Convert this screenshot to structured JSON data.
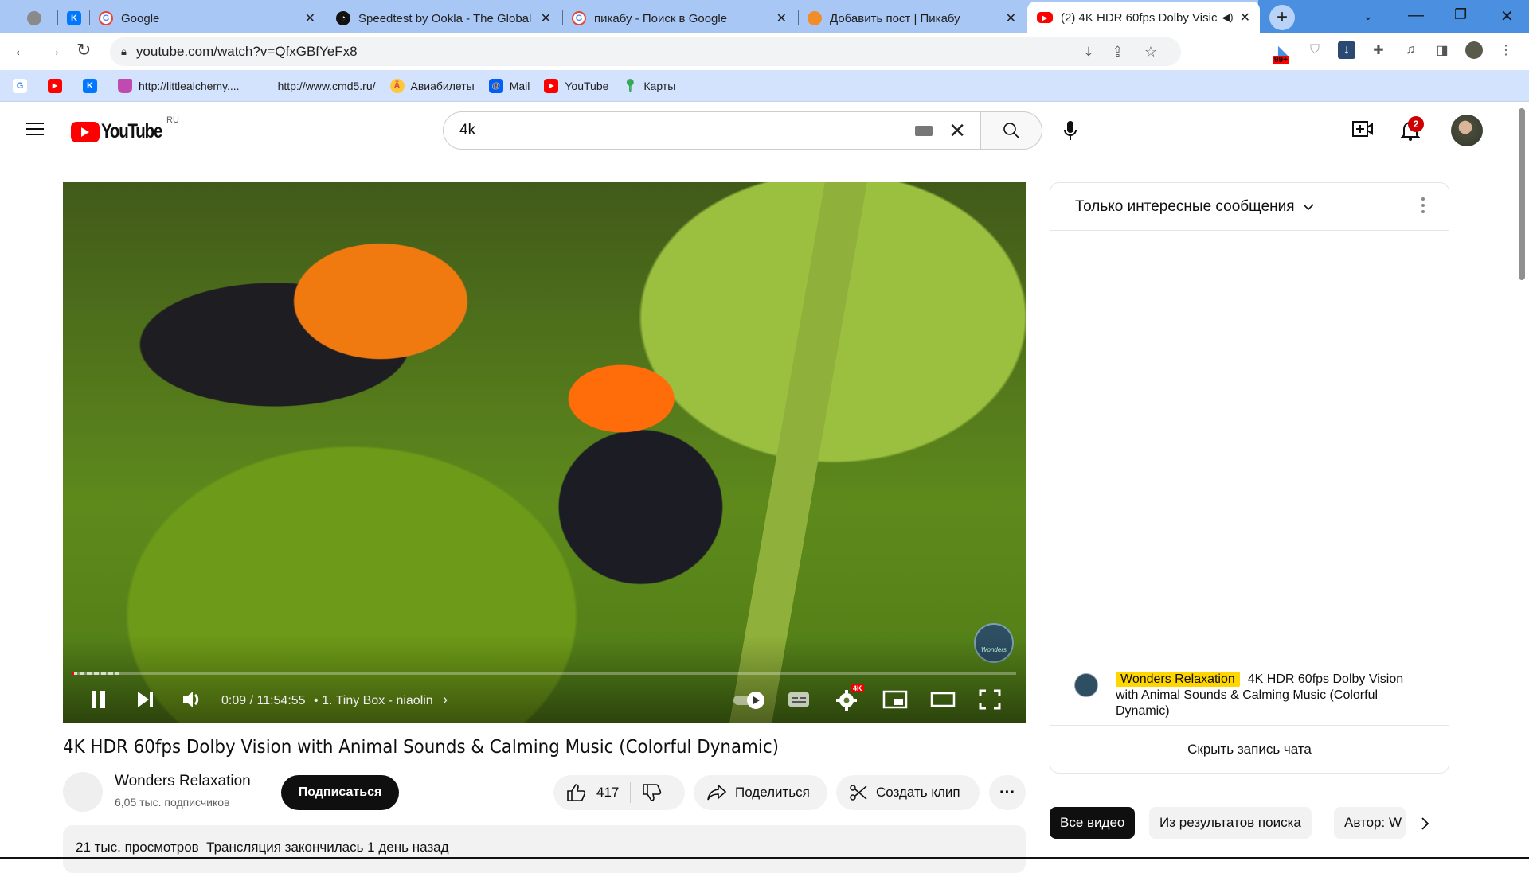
{
  "browser": {
    "tabs": [
      {
        "title": "",
        "icon": "globe-icon"
      },
      {
        "title": "",
        "icon": "vk-icon"
      },
      {
        "title": "Google",
        "icon": "google-icon"
      },
      {
        "title": "Speedtest by Ookla - The Global",
        "icon": "speedtest-icon"
      },
      {
        "title": "пикабу - Поиск в Google",
        "icon": "google-icon"
      },
      {
        "title": "Добавить пост | Пикабу",
        "icon": "pikabu-icon"
      },
      {
        "title": "(2) 4K HDR 60fps Dolby Visic",
        "icon": "youtube-icon",
        "active": true,
        "audio": true
      }
    ],
    "url": "youtube.com/watch?v=QfxGBfYeFx8",
    "extension_badge": "99+",
    "bookmarks": [
      {
        "label": "",
        "icon": "google-icon"
      },
      {
        "label": "",
        "icon": "youtube-icon"
      },
      {
        "label": "",
        "icon": "vk-icon"
      },
      {
        "label": "http://littlealchemy....",
        "icon": "flask-icon"
      },
      {
        "label": "http://www.cmd5.ru/",
        "icon": ""
      },
      {
        "label": "Авиабилеты",
        "icon": "plane-icon"
      },
      {
        "label": "Mail",
        "icon": "mail-icon"
      },
      {
        "label": "YouTube",
        "icon": "youtube-icon"
      },
      {
        "label": "Карты",
        "icon": "maps-icon"
      }
    ]
  },
  "youtube": {
    "logo_text": "YouTube",
    "region": "RU",
    "search_value": "4k",
    "notification_count": "2",
    "player": {
      "current_time": "0:09",
      "duration": "11:54:55",
      "time_display": "0:09 / 11:54:55",
      "chapter": "• 1. Tiny Box - niaolin",
      "progress_fraction": 0.0002,
      "quality_badge": "4K",
      "watermark": "Wonders"
    },
    "video": {
      "title": "4K HDR 60fps Dolby Vision with Animal Sounds & Calming Music (Colorful Dynamic)",
      "channel": "Wonders Relaxation",
      "subscribers": "6,05 тыс. подписчиков",
      "subscribe_label": "Подписаться",
      "likes": "417",
      "share_label": "Поделиться",
      "clip_label": "Создать клип",
      "views_info": "21 тыс. просмотров  Трансляция закончилась 1 день назад"
    },
    "chat": {
      "mode": "Только интересные сообщения",
      "message": {
        "author": "Wonders Relaxation",
        "text": "4K HDR 60fps Dolby Vision with Animal Sounds & Calming Music (Colorful Dynamic)"
      },
      "hide_label": "Скрыть запись чата"
    },
    "chips": [
      {
        "label": "Все видео",
        "active": true
      },
      {
        "label": "Из результатов поиска",
        "active": false
      },
      {
        "label": "Автор: W",
        "active": false
      }
    ]
  }
}
